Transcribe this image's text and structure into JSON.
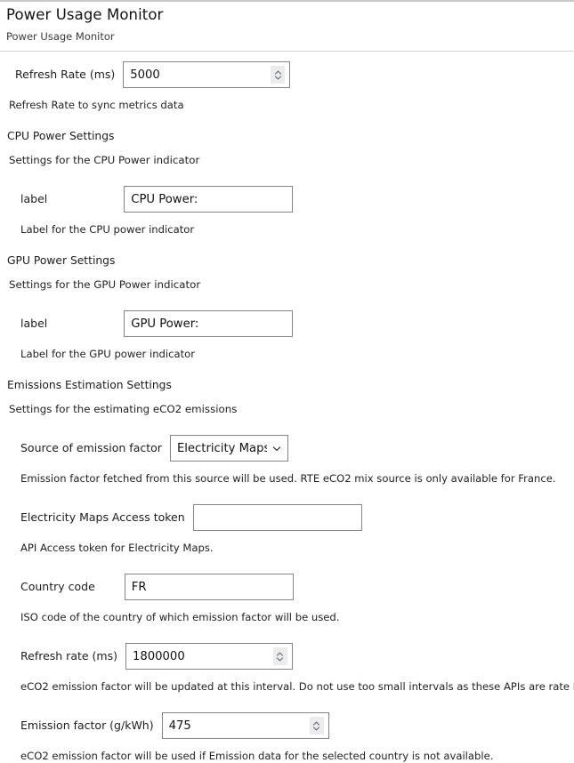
{
  "header": {
    "title": "Power Usage Monitor",
    "subtitle": "Power Usage Monitor"
  },
  "settings": {
    "refresh_rate": {
      "label": "Refresh Rate (ms)",
      "value": "5000",
      "description": "Refresh Rate to sync metrics data"
    },
    "cpu_section": {
      "heading": "CPU Power Settings",
      "description": "Settings for the CPU Power indicator",
      "label_field": {
        "label": "label",
        "value": "CPU Power:",
        "description": "Label for the CPU power indicator"
      }
    },
    "gpu_section": {
      "heading": "GPU Power Settings",
      "description": "Settings for the GPU Power indicator",
      "label_field": {
        "label": "label",
        "value": "GPU Power:",
        "description": "Label for the GPU power indicator"
      }
    },
    "emissions_section": {
      "heading": "Emissions Estimation Settings",
      "description": "Settings for the estimating eCO2 emissions",
      "source": {
        "label": "Source of emission factor",
        "value": "Electricity Maps",
        "description": "Emission factor fetched from this source will be used. RTE eCO2 mix source is only available for France."
      },
      "access_token": {
        "label": "Electricity Maps Access token",
        "value": "",
        "description": "API Access token for Electricity Maps."
      },
      "country_code": {
        "label": "Country code",
        "value": "FR",
        "description": "ISO code of the country of which emission factor will be used."
      },
      "refresh_rate": {
        "label": "Refresh rate (ms)",
        "value": "1800000",
        "description": "eCO2 emission factor will be updated at this interval. Do not use too small intervals as these APIs are rate limited."
      },
      "emission_factor": {
        "label": "Emission factor (g/kWh)",
        "value": "475",
        "description": "eCO2 emission factor will be used if Emission data for the selected country is not available."
      }
    }
  },
  "icons": {
    "spinner": "number-spinner-icon",
    "select_arrow": "chevron-down-icon"
  },
  "colors": {
    "border": "#848484",
    "divider": "#d6d6d6",
    "text": "#1a1a1a"
  }
}
